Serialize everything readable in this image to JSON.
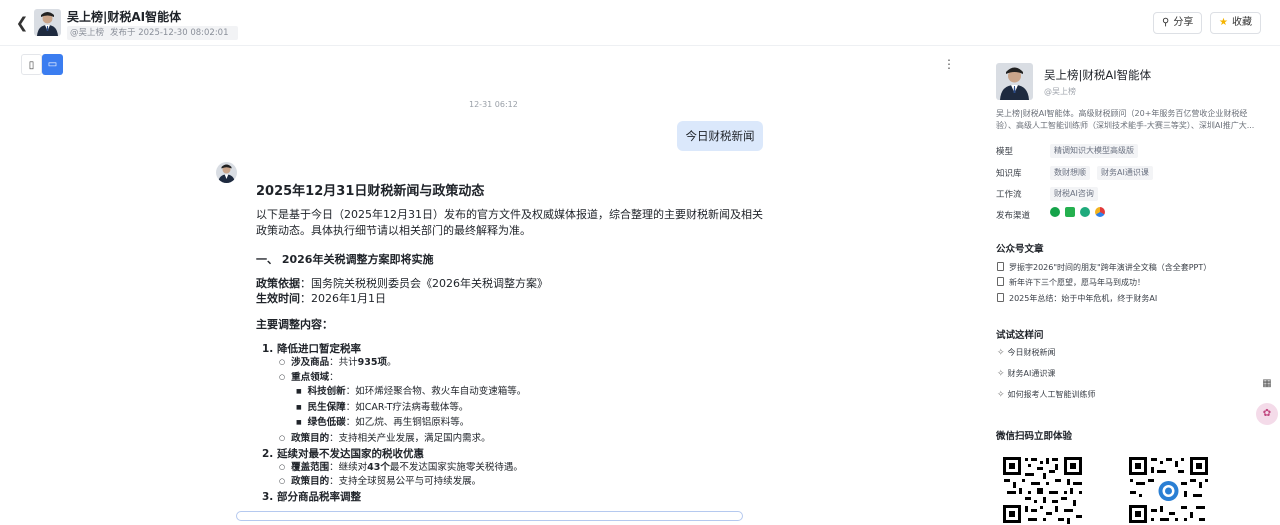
{
  "header": {
    "title": "吴上榜|财税AI智能体",
    "author": "@吴上榜",
    "published": "发布于 2025-12-30 08:02:01",
    "share_label": "分享",
    "favorite_label": "收藏"
  },
  "chat": {
    "timestamp": "12-31 06:12",
    "user_message": "今日财税新闻",
    "answer": {
      "title": "2025年12月31日财税新闻与政策动态",
      "intro": "以下是基于今日（2025年12月31日）发布的官方文件及权威媒体报道，综合整理的主要财税新闻及相关政策动态。具体执行细节请以相关部门的最终解释为准。",
      "section1": "一、 2026年关税调整方案即将实施",
      "basis_label": "政策依据",
      "basis_value": "：国务院关税税则委员会《2026年关税调整方案》",
      "effective_label": "生效时间",
      "effective_value": "：2026年1月1日",
      "main_content": "主要调整内容：",
      "items": [
        {
          "head": "1. 降低进口暂定税率",
          "scope_label": "涉及商品",
          "scope_pre": "：共计",
          "scope_bold": "935项",
          "scope_post": "。",
          "focus_label": "重点领域",
          "focus_post": "：",
          "tech_label": "科技创新",
          "tech_value": "：如环烯烃聚合物、救火车自动变速箱等。",
          "welfare_label": "民生保障",
          "welfare_value": "：如CAR-T疗法病毒载体等。",
          "green_label": "绿色低碳",
          "green_value": "：如乙烷、再生铜铝原料等。",
          "goal_label": "政策目的",
          "goal_value": "：支持相关产业发展，满足国内需求。"
        },
        {
          "head": "2. 延续对最不发达国家的税收优惠",
          "cover_label": "覆盖范围",
          "cover_pre": "：继续对",
          "cover_bold": "43个",
          "cover_post": "最不发达国家实施零关税待遇。",
          "goal_label": "政策目的",
          "goal_value": "：支持全球贸易公平与可持续发展。"
        },
        {
          "head": "3. 部分商品税率调整"
        }
      ]
    }
  },
  "sidebar": {
    "name": "吴上榜|财税AI智能体",
    "handle": "@吴上榜",
    "description": "吴上榜|财税AI智能体。高级财税顾问（20+年服务百亿营收企业财税经验）、高级人工智能训练师（深圳技术能手-大赛三等奖）、深圳AI推广大...",
    "model_label": "模型",
    "model_value": "精调知识大模型高级版",
    "kb_label": "知识库",
    "kb_values": [
      "数财想顺",
      "财务AI通识课"
    ],
    "workflow_label": "工作流",
    "workflow_value": "财税AI咨询",
    "channel_label": "发布渠道",
    "articles_title": "公众号文章",
    "articles": [
      "罗振宇2026\"时间的朋友\"跨年演讲全文稿（含全套PPT）",
      "新年许下三个愿望，愿马年马到成功！",
      "2025年总结：始于中年危机，终于财务AI"
    ],
    "try_title": "试试这样问",
    "try_items": [
      "今日财税新闻",
      "财务AI通识课",
      "如何报考人工智能训练师"
    ],
    "qr_title": "微信扫码立即体验"
  }
}
